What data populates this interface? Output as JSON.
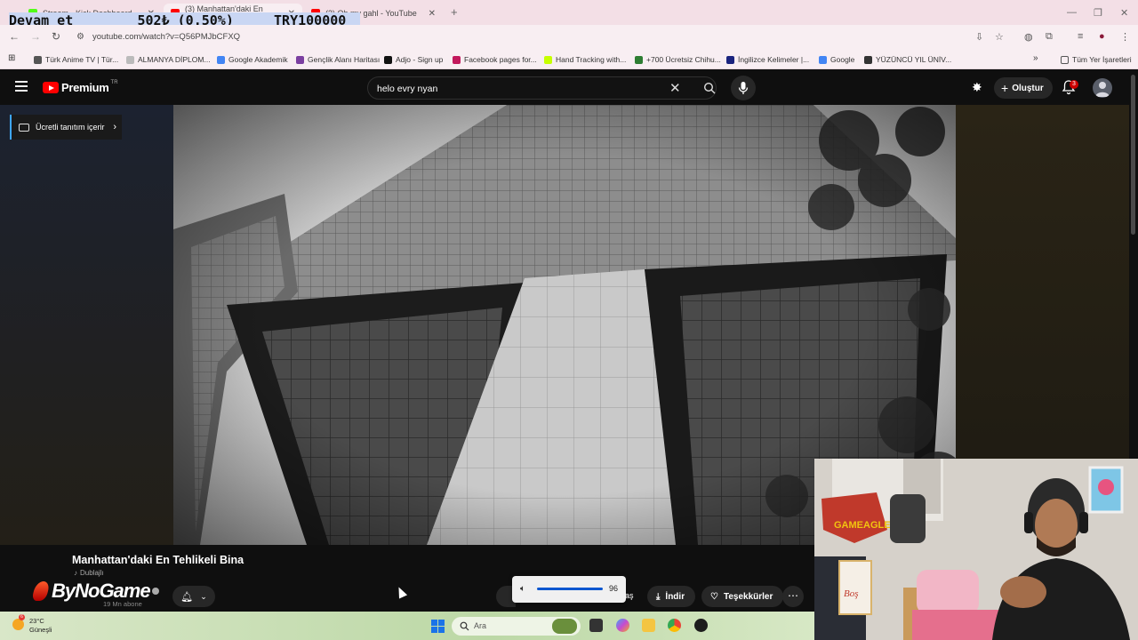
{
  "browser": {
    "overlay_text": "Devam et        502₺ (0.50%)     TRY100000",
    "tabs": [
      {
        "title": "Stream - Kick Dashboard",
        "icon": "kick-icon",
        "color": "#53fc18"
      },
      {
        "title": "(3) Manhattan'daki En Tehli...",
        "icon": "youtube-icon",
        "color": "#ff0000"
      },
      {
        "title": "(3) Oh my gahl - YouTube",
        "icon": "youtube-icon",
        "color": "#ff0000"
      }
    ],
    "new_tab": "+",
    "url": "youtube.com/watch?v=Q56PMJbCFXQ",
    "bookmarks": [
      {
        "label": "Türk Anime TV | Tür...",
        "color": "#555555"
      },
      {
        "label": "ALMANYA DİPLOM...",
        "color": "#bbbbbb"
      },
      {
        "label": "Google Akademik",
        "color": "#4285f4"
      },
      {
        "label": "Gençlik Alanı Haritası",
        "color": "#7b3fa0"
      },
      {
        "label": "Adjo - Sign up",
        "color": "#111111"
      },
      {
        "label": "Facebook pages for...",
        "color": "#c2185b"
      },
      {
        "label": "Hand Tracking with...",
        "color": "#c6ff00"
      },
      {
        "label": "+700 Ücretsiz Chihu...",
        "color": "#2e7d32"
      },
      {
        "label": "İngilizce Kelimeler |...",
        "color": "#1a237e"
      },
      {
        "label": "Google",
        "color": "#4285f4"
      },
      {
        "label": "YÜZÜNCÜ YIL ÜNİV...",
        "color": "#333333"
      }
    ],
    "bookmarks_more": "»",
    "all_bookmarks": "Tüm Yer İşaretleri"
  },
  "youtube": {
    "logo": "Premium",
    "logo_region": "TR",
    "search_value": "helo evry nyan",
    "create_label": "Oluştur",
    "notification_count": "3",
    "promo_label": "Ücretli tanıtım içerir",
    "video_title": "Manhattan'daki En Tehlikeli Bina",
    "dub_label": "Dublajlı",
    "channel_logo_text": "ByNoGame",
    "subscribers": "19 Mn abone",
    "volume_value": "96",
    "share_partial": "aş",
    "download_label": "İndir",
    "thanks_label": "Teşekkürler",
    "more_label": "⋯"
  },
  "taskbar": {
    "weather_temp": "23°C",
    "weather_text": "Güneşli",
    "weather_badge": "6",
    "search_placeholder": "Ara"
  }
}
